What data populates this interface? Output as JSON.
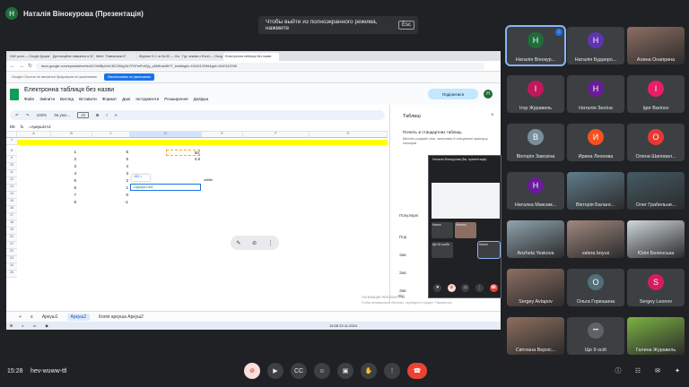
{
  "meeting": {
    "presenter_initial": "Н",
    "presenter_label": "Наталія Вінокурова (Презентація)",
    "fullscreen_toast": "Чтобы выйти из полноэкранного режима, нажмите",
    "esc_key": "Esc",
    "time": "15:28",
    "meeting_code": "hev-wuww-ttl"
  },
  "browser": {
    "tabs": [
      "НАУ розп — Google Докум",
      "Дистанційне навчання в ЗСП",
      "Meet: \"Навчальна 6\"",
      "Журнал 9-1 та 2b-03 — Google",
      "Гід: чекова з Excel — Google",
      "Електронна таблиця без назви"
    ],
    "url": "docs.google.com/spreadsheets/d/1Ok9Bp0rhC8C2K6g2tLYF0FmPo9Qy_p5MKdz68YT_t/edit#gid=1540112096&gid=1540112096",
    "info_text": "Google Chrome не является браузером по умолчанию",
    "default_button": "Использовать по умолчанию"
  },
  "sheets": {
    "title": "Електронна таблиця без назви",
    "menus": [
      "Файл",
      "Змінити",
      "Вигляд",
      "Вставити",
      "Формат",
      "Дані",
      "Інструменти",
      "Розширення",
      "Довідка"
    ],
    "share": "Поділитися",
    "user_initial": "Н",
    "toolbar": {
      "zoom": "100%",
      "font": "За умо...",
      "font_size": "10"
    },
    "cell_ref": "D8",
    "formula": "=Аркуш1!A4",
    "columns": [
      "A",
      "B",
      "C",
      "D",
      "E",
      "F",
      "G"
    ],
    "rows": [
      "1",
      "8",
      "9",
      "10",
      "11",
      "12",
      "13",
      "14",
      "15",
      "16",
      "17",
      "18",
      "19",
      "20",
      "21",
      "22",
      "23",
      "24",
      "25"
    ],
    "col_a": [
      "1",
      "2",
      "3",
      "4",
      "5",
      "6",
      "7",
      "8"
    ],
    "col_b": [
      "6",
      "5",
      "4",
      "3",
      "2",
      "1",
      "0",
      "-1"
    ],
    "col_d": [
      "50",
      "4.5"
    ],
    "e_cell": "ckbbk",
    "hint_chip": "183 ×",
    "edit_value": "=Аркуш1!A4",
    "side_panel": {
      "title": "Таблиці",
      "subtitle": "Почніть зі стандартних таблиць",
      "description": "Містить розумні чіпи, заголовки й спеціальні прапорці кольорів",
      "items": [
        "Популярні",
        "Пор",
        "Зав",
        "Зав",
        "Зав",
        "Від"
      ]
    },
    "activate_windows": "Активация Windows",
    "activate_windows_sub": "Чтобы активировать Windows, перейдите в раздел \"Параметры\".",
    "sheet_tabs": [
      "Аркуш1",
      "Аркуш2",
      "Копія аркуша Аркуш2"
    ],
    "taskbar_time": "15:28",
    "taskbar_date": "22.11.2024"
  },
  "mini_meet": {
    "title": "Наталія Вінокурова (Ви, презентація)",
    "tiles": [
      "Наталі",
      "Наталія",
      "Ще 34 особи",
      "Наталі"
    ]
  },
  "participants": [
    {
      "name": "Наталія Вінокур...",
      "initial": "Н",
      "color": "#1e6e3a",
      "speaking": true
    },
    {
      "name": "Наталія Будапро...",
      "initial": "Н",
      "color": "#5e35b1"
    },
    {
      "name": "Алина Онаприна",
      "initial": "",
      "color": "#8d6e63",
      "photo": true
    },
    {
      "name": "Ігор Журавель",
      "initial": "І",
      "color": "#c2185b"
    },
    {
      "name": "Наталія Зенїна",
      "initial": "Н",
      "color": "#6a1b9a"
    },
    {
      "name": "Igor Barinov",
      "initial": "I",
      "color": "#e91e63"
    },
    {
      "name": "Вікторія Завозіна",
      "initial": "В",
      "color": "#78909c"
    },
    {
      "name": "Ирина Леонова",
      "initial": "И",
      "color": "#f4511e"
    },
    {
      "name": "Олена Шаповал...",
      "initial": "О",
      "color": "#e53935"
    },
    {
      "name": "Наталка Максим...",
      "initial": "Н",
      "color": "#6a1b9a"
    },
    {
      "name": "Вікторія Баланс...",
      "initial": "",
      "color": "#607d8b",
      "photo": true
    },
    {
      "name": "Олег Грабельни...",
      "initial": "",
      "color": "#455a64",
      "photo": true
    },
    {
      "name": "Anzhela Yeskova",
      "initial": "",
      "color": "#90a4ae",
      "photo": true
    },
    {
      "name": "valera boyus",
      "initial": "",
      "color": "#a1887f",
      "photo": true
    },
    {
      "name": "Юлія Беленська",
      "initial": "",
      "color": "#cfd8dc",
      "photo": true
    },
    {
      "name": "Sergey Avtapov",
      "initial": "",
      "color": "#8d6e63",
      "photo": true
    },
    {
      "name": "Ольга Горюшина",
      "initial": "О",
      "color": "#546e7a"
    },
    {
      "name": "Sergey Leonov",
      "initial": "S",
      "color": "#d81b60"
    },
    {
      "name": "Світлана Верхіс...",
      "initial": "",
      "color": "#8e6e5e",
      "photo": true
    },
    {
      "name": "Ще 9 осіб",
      "initial": "",
      "color": "#3c4043"
    },
    {
      "name": "Галина Журавель",
      "initial": "",
      "color": "#7cb342",
      "photo": true
    }
  ],
  "colors": {
    "accent": "#8ab4f8",
    "hangup": "#ea4335",
    "mic_off": "#f9dedc"
  }
}
